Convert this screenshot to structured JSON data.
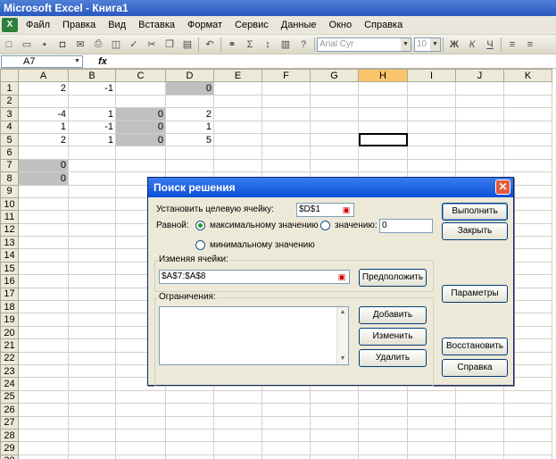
{
  "app": {
    "title": "Microsoft Excel - Книга1"
  },
  "menu": {
    "icon": "excel-app-icon",
    "items": [
      "Файл",
      "Правка",
      "Вид",
      "Вставка",
      "Формат",
      "Сервис",
      "Данные",
      "Окно",
      "Справка"
    ]
  },
  "toolbar": {
    "font_name": "Arial Cyr",
    "font_size": "10",
    "bold": "Ж",
    "italic": "К",
    "underline": "Ч",
    "sigma": "Σ",
    "icons": [
      "new-icon",
      "open-icon",
      "save-icon",
      "permission-icon",
      "email-icon",
      "print-icon",
      "print-preview-icon",
      "spelling-icon",
      "cut-icon",
      "copy-icon",
      "paste-icon",
      "undo-icon",
      "hyperlink-icon",
      "autosum-icon",
      "sort-icon",
      "chart-icon",
      "help-icon",
      "align-left-icon",
      "align-center-icon",
      "align-right-icon"
    ]
  },
  "formula_bar": {
    "name_box": "A7",
    "fx": "fx",
    "content": ""
  },
  "sheet": {
    "columns": [
      "A",
      "B",
      "C",
      "D",
      "E",
      "F",
      "G",
      "H",
      "I",
      "J",
      "K"
    ],
    "rows": [
      "1",
      "2",
      "3",
      "4",
      "5",
      "6",
      "7",
      "8",
      "9",
      "10",
      "11",
      "12",
      "13",
      "14",
      "15",
      "16",
      "17",
      "18",
      "19",
      "20",
      "21",
      "22",
      "23",
      "24",
      "25",
      "26",
      "27",
      "28",
      "29",
      "30"
    ],
    "cells": {
      "1": {
        "A": "2",
        "B": "-1",
        "D": "0"
      },
      "3": {
        "A": "-4",
        "B": "1",
        "C": "0",
        "D": "2"
      },
      "4": {
        "A": "1",
        "B": "-1",
        "C": "0",
        "D": "1"
      },
      "5": {
        "A": "2",
        "B": "1",
        "C": "0",
        "D": "5"
      },
      "7": {
        "A": "0"
      },
      "8": {
        "A": "0"
      }
    }
  },
  "dialog": {
    "title": "Поиск решения",
    "set_target_label": "Установить целевую ячейку:",
    "target_value": "$D$1",
    "equal_label": "Равной:",
    "max_label": "максимальному значению",
    "value_label": "значению:",
    "value_input": "0",
    "min_label": "минимальному значению",
    "changing_label": "Изменяя ячейки:",
    "changing_value": "$A$7:$A$8",
    "guess_button": "Предположить",
    "constraints_label": "Ограничения:",
    "add_button": "Добавить",
    "change_button": "Изменить",
    "delete_button": "Удалить",
    "solve_button": "Выполнить",
    "close_button": "Закрыть",
    "options_button": "Параметры",
    "reset_button": "Восстановить",
    "help_button": "Справка"
  }
}
